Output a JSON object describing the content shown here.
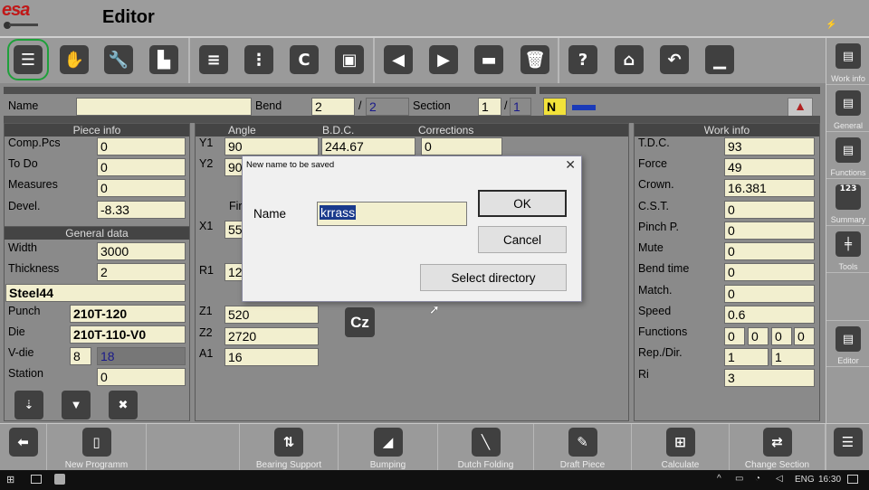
{
  "app": {
    "logo": "esa",
    "title": "Editor"
  },
  "toolbar": {
    "icons": [
      "document-icon",
      "hand-icon",
      "wrench-icon",
      "factory-icon",
      "layers-icon",
      "stack-icon",
      "c-icon",
      "save-icon",
      "arrow-left-icon",
      "arrow-right-icon",
      "minus-box-icon",
      "trash-icon",
      "help-icon",
      "home-icon",
      "undo-icon",
      "minimize-icon"
    ]
  },
  "sidebar": {
    "items": [
      {
        "label": "Work info"
      },
      {
        "label": "General"
      },
      {
        "label": "Functions"
      },
      {
        "label": "Summary",
        "badge": "123"
      },
      {
        "label": "Tools"
      },
      {
        "label": "Editor"
      }
    ]
  },
  "header": {
    "name_label": "Name",
    "name_value": "",
    "bend_label": "Bend",
    "bend_value": "2",
    "bend_sep": "/",
    "bend_total": "2",
    "section_label": "Section",
    "section_value": "1",
    "section_sep": "/",
    "section_total": "1",
    "status_letter": "N"
  },
  "piece_info": {
    "title": "Piece info",
    "rows": [
      {
        "label": "Comp.Pcs",
        "value": "0"
      },
      {
        "label": "To Do",
        "value": "0"
      },
      {
        "label": "Measures",
        "value": "0"
      },
      {
        "label": "Devel.",
        "value": "-8.33"
      }
    ]
  },
  "general_data": {
    "title": "General data",
    "width_label": "Width",
    "width_value": "3000",
    "thickness_label": "Thickness",
    "thickness_value": "2",
    "material": "Steel44",
    "punch_label": "Punch",
    "punch_value": "210T-120",
    "die_label": "Die",
    "die_value": "210T-110-V0",
    "vdie_label": "V-die",
    "vdie_a": "8",
    "vdie_b": "18",
    "station_label": "Station",
    "station_value": "0"
  },
  "bend_panel": {
    "angle_header": "Angle",
    "bdc_header": "B.D.C.",
    "corr_header": "Corrections",
    "y1_label": "Y1",
    "y1_angle": "90",
    "y1_bdc": "244.67",
    "y1_corr": "0",
    "y2_label": "Y2",
    "y2_angle": "90",
    "fin_label": "Fir",
    "x1_label": "X1",
    "x1_value": "55",
    "r1_label": "R1",
    "r1_value": "12",
    "z1_label": "Z1",
    "z1_value": "520",
    "z2_label": "Z2",
    "z2_value": "2720",
    "a1_label": "A1",
    "a1_value": "16",
    "cz_label": "Cz"
  },
  "work_info": {
    "title": "Work info",
    "rows": [
      {
        "label": "T.D.C.",
        "value": "93"
      },
      {
        "label": "Force",
        "value": "49"
      },
      {
        "label": "Crown.",
        "value": "16.381"
      },
      {
        "label": "C.S.T.",
        "value": "0"
      },
      {
        "label": "Pinch P.",
        "value": "0"
      },
      {
        "label": "Mute",
        "value": "0"
      },
      {
        "label": "Bend time",
        "value": "0"
      },
      {
        "label": "Match.",
        "value": "0"
      },
      {
        "label": "Speed",
        "value": "0.6"
      }
    ],
    "functions_label": "Functions",
    "functions_values": [
      "0",
      "0",
      "0",
      "0"
    ],
    "repdir_label": "Rep./Dir.",
    "repdir_values": [
      "1",
      "1"
    ],
    "ri_label": "Ri",
    "ri_value": "3"
  },
  "dialog": {
    "title": "New name to be saved",
    "name_label": "Name",
    "name_value": "krrass",
    "ok_label": "OK",
    "cancel_label": "Cancel",
    "select_dir_label": "Select directory"
  },
  "bottombar": {
    "items": [
      {
        "label": "",
        "icon": "back-arrow-icon"
      },
      {
        "label": "New Programm",
        "icon": "new-file-icon"
      },
      {
        "label": "Bearing Support",
        "icon": "bearing-support-icon"
      },
      {
        "label": "Bumping",
        "icon": "bumping-icon"
      },
      {
        "label": "Dutch Folding",
        "icon": "dutch-folding-icon"
      },
      {
        "label": "Draft Piece",
        "icon": "draft-piece-icon"
      },
      {
        "label": "Calculate",
        "icon": "calculate-icon"
      },
      {
        "label": "Change Section",
        "icon": "change-section-icon"
      },
      {
        "label": "",
        "icon": "list-icon"
      }
    ]
  },
  "taskbar": {
    "lang": "ENG",
    "time": "16:30"
  }
}
